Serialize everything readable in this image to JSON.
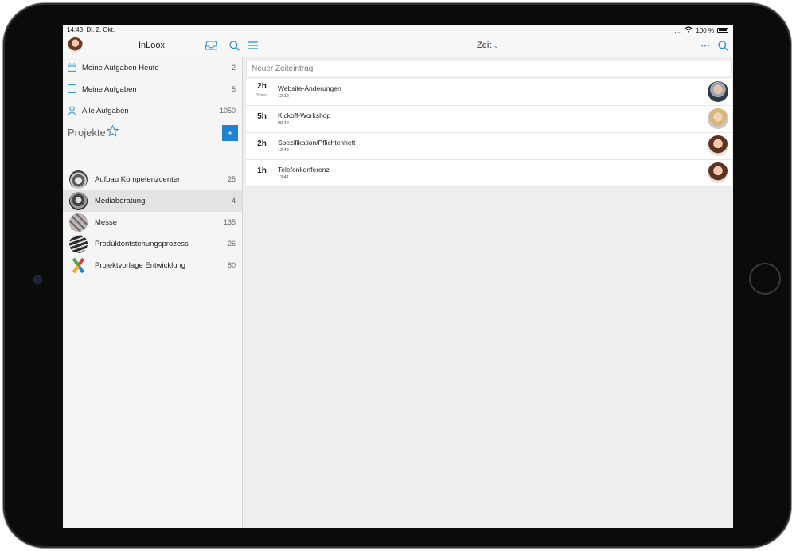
{
  "status_bar": {
    "time": "14:43",
    "date": "Di. 2. Okt.",
    "signal": "....",
    "battery": "100 %"
  },
  "header": {
    "app_title": "InLoox",
    "view_title": "Zeit"
  },
  "sidebar": {
    "tasks": [
      {
        "label": "Meine Aufgaben Heute",
        "count": "2",
        "icon": "calendar-icon"
      },
      {
        "label": "Meine Aufgaben",
        "count": "5",
        "icon": "checkbox-icon"
      },
      {
        "label": "Alle Aufgaben",
        "count": "1050",
        "icon": "person-icon"
      }
    ],
    "projects_heading": "Projekte",
    "add_label": "+",
    "projects": [
      {
        "label": "Aufbau Kompetenzcenter",
        "count": "25",
        "selected": false
      },
      {
        "label": "Mediaberatung",
        "count": "4",
        "selected": true
      },
      {
        "label": "Messe",
        "count": "135",
        "selected": false
      },
      {
        "label": "Produktentstehungsprozess",
        "count": "26",
        "selected": false
      },
      {
        "label": "Projektvorlage Entwicklung",
        "count": "80",
        "selected": false
      }
    ]
  },
  "main": {
    "new_entry_placeholder": "Neuer Zeiteintrag",
    "entries": [
      {
        "duration": "2h",
        "duration_sub": "30min",
        "title": "Website-Änderungen",
        "time": "12:12",
        "avatar": "man-grey"
      },
      {
        "duration": "5h",
        "duration_sub": "",
        "title": "Kickoff-Workshop",
        "time": "09:42",
        "avatar": "woman-blonde"
      },
      {
        "duration": "2h",
        "duration_sub": "",
        "title": "Spezifikation/Pflichtenheft",
        "time": "12:42",
        "avatar": "woman-brown"
      },
      {
        "duration": "1h",
        "duration_sub": "",
        "title": "Telefonkonferenz",
        "time": "13:41",
        "avatar": "woman-brown"
      }
    ]
  },
  "colors": {
    "accent": "#2a8fd6",
    "nav_border": "#5aa832",
    "add_button": "#1f82d2"
  }
}
